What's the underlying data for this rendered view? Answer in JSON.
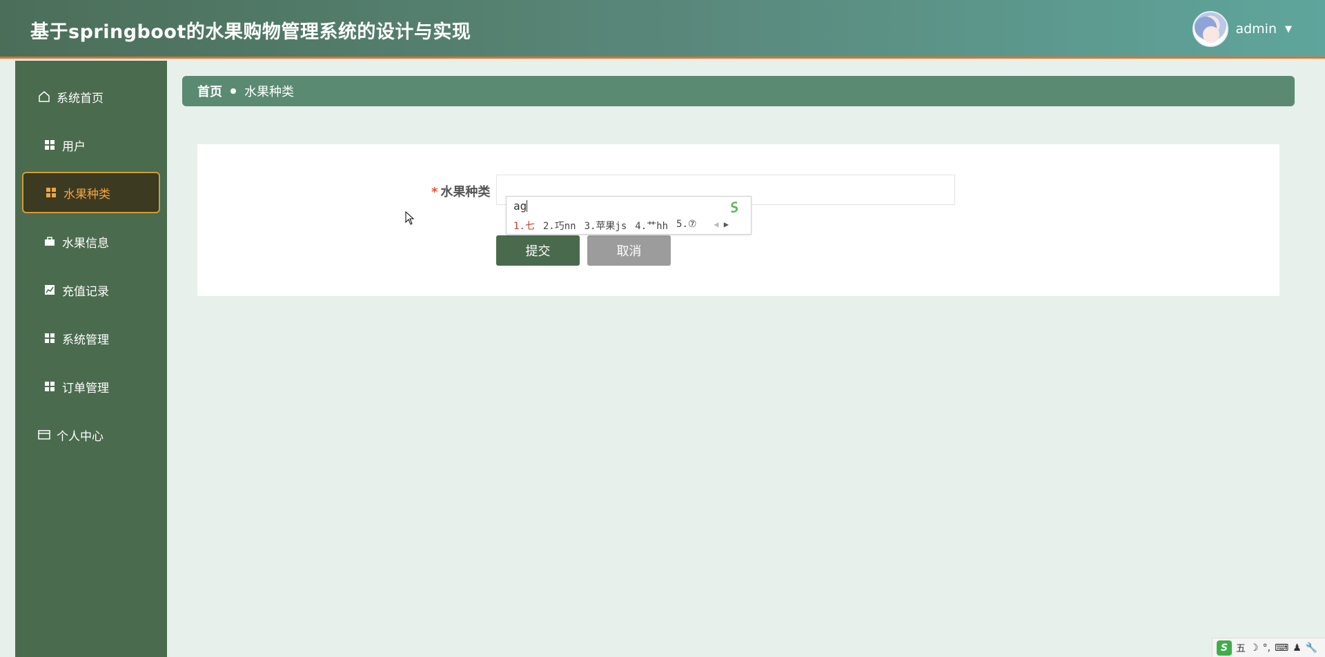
{
  "header": {
    "title": "基于springboot的水果购物管理系统的设计与实现",
    "username": "admin",
    "caret": "▼"
  },
  "sidebar": {
    "items": [
      {
        "label": "系统首页",
        "icon": "home-icon"
      },
      {
        "label": "用户",
        "icon": "grid-icon"
      },
      {
        "label": "水果种类",
        "icon": "grid-icon",
        "active": true
      },
      {
        "label": "水果信息",
        "icon": "briefcase-icon"
      },
      {
        "label": "充值记录",
        "icon": "chart-icon"
      },
      {
        "label": "系统管理",
        "icon": "grid-icon"
      },
      {
        "label": "订单管理",
        "icon": "grid-icon"
      },
      {
        "label": "个人中心",
        "icon": "card-icon"
      }
    ]
  },
  "breadcrumb": {
    "home": "首页",
    "current": "水果种类"
  },
  "form": {
    "required_mark": "*",
    "label": "水果种类",
    "value": "",
    "submit_label": "提交",
    "cancel_label": "取消"
  },
  "ime": {
    "composition": "ag",
    "candidates": [
      "1.七",
      "2.巧nn",
      "3.苹果js",
      "4.艹hh",
      "5.⑦"
    ],
    "logo": "S"
  },
  "taskbar_ime": {
    "logo": "S",
    "mode": "五",
    "moon": "☽",
    "punct": "°,",
    "keyboard": "⌨",
    "person": "♟",
    "wrench": "🔧"
  },
  "colors": {
    "accent": "#e0732a",
    "sidebar": "#4b6b4f",
    "active_text": "#f4a340",
    "breadcrumb_bg": "#5a8a72",
    "submit_bg": "#4a6a4e",
    "cancel_bg": "#9c9c9c"
  }
}
